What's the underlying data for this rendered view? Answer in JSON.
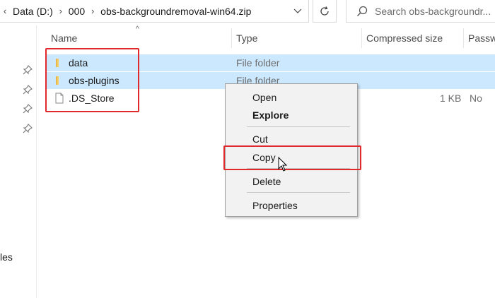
{
  "breadcrumb": {
    "items": [
      "Data (D:)",
      "000",
      "obs-backgroundremoval-win64.zip"
    ]
  },
  "search": {
    "placeholder": "Search obs-backgroundr..."
  },
  "nav": {
    "partial_label": "les"
  },
  "columns": {
    "name": "Name",
    "type": "Type",
    "compressed_size": "Compressed size",
    "password": "Passw"
  },
  "files": [
    {
      "name": "data",
      "type": "File folder",
      "size": "",
      "password": "",
      "icon": "folder-icon",
      "selected": true
    },
    {
      "name": "obs-plugins",
      "type": "File folder",
      "size": "",
      "password": "",
      "icon": "folder-icon",
      "selected": true
    },
    {
      "name": ".DS_Store",
      "type": "",
      "size": "1 KB",
      "password": "No",
      "icon": "file-icon",
      "selected": false
    }
  ],
  "context_menu": {
    "items": [
      {
        "label": "Open",
        "bold": false
      },
      {
        "label": "Explore",
        "bold": true
      },
      {
        "label": "Cut",
        "bold": false
      },
      {
        "label": "Copy",
        "bold": false
      },
      {
        "label": "Delete",
        "bold": false
      },
      {
        "label": "Properties",
        "bold": false
      }
    ]
  },
  "colors": {
    "selection": "#cce8ff",
    "highlight_box": "#e0282d",
    "folder": "#e8b64a"
  }
}
